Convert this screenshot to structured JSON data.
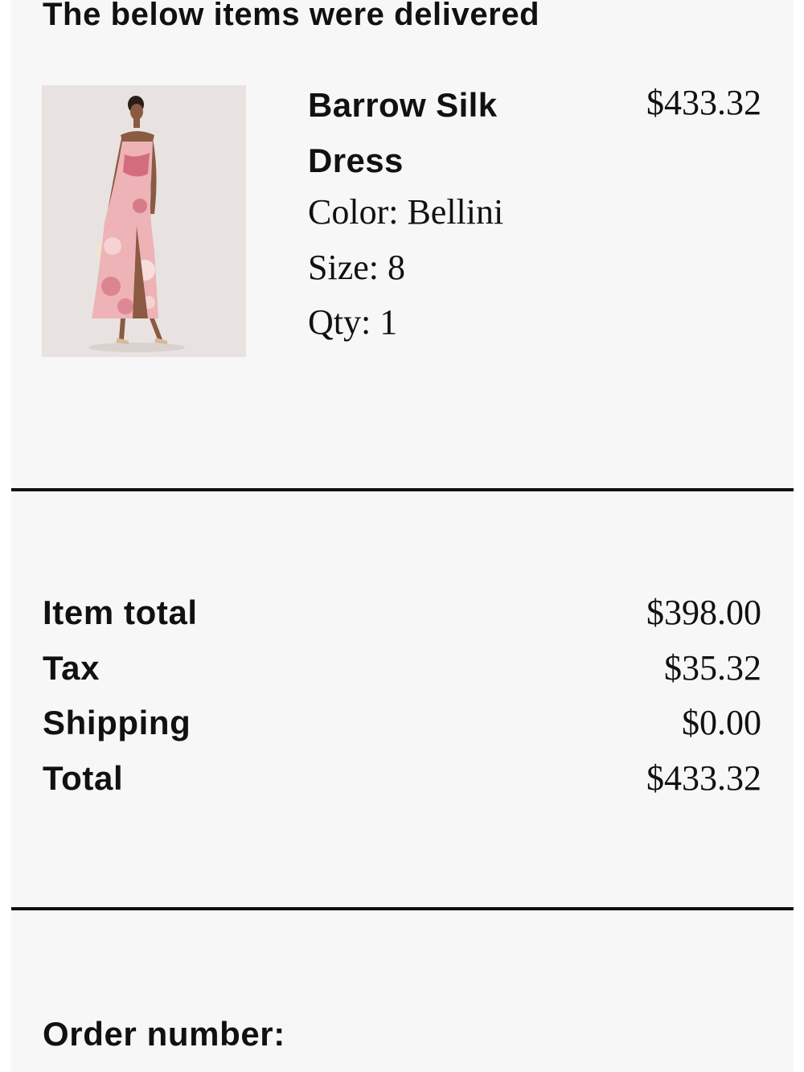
{
  "section": {
    "heading": "The below items were delivered"
  },
  "item": {
    "image_alt": "Model wearing pink floral strapless silk dress",
    "name": "Barrow Silk Dress",
    "price": "$433.32",
    "color": "Color: Bellini",
    "size": "Size: 8",
    "qty": "Qty: 1"
  },
  "summary": {
    "rows": [
      {
        "label": "Item total",
        "value": "$398.00"
      },
      {
        "label": "Tax",
        "value": "$35.32"
      },
      {
        "label": "Shipping",
        "value": "$0.00"
      },
      {
        "label": "Total",
        "value": "$433.32"
      }
    ]
  },
  "order": {
    "label": "Order number:"
  }
}
